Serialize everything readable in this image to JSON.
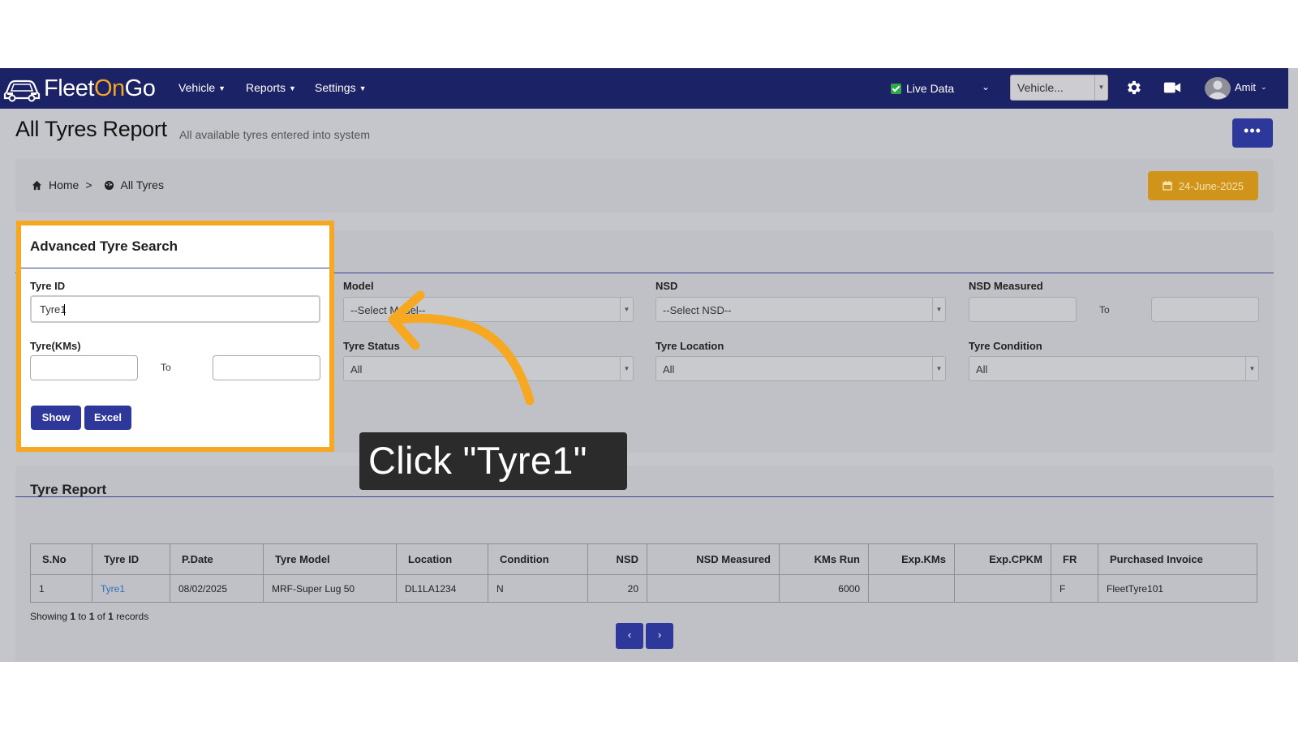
{
  "navbar": {
    "logo": {
      "part1": "Fleet",
      "part2": "On",
      "part3": "Go"
    },
    "menus": [
      {
        "label": "Vehicle"
      },
      {
        "label": "Reports"
      },
      {
        "label": "Settings"
      }
    ],
    "live_data_label": "Live Data",
    "live_data_checked": true,
    "vehicle_select_value": "Vehicle...",
    "user_name": "Amit"
  },
  "page": {
    "title": "All Tyres Report",
    "subtitle": "All available tyres entered into system",
    "more_label": "•••"
  },
  "breadcrumb": {
    "home": "Home",
    "separator": ">",
    "current": "All Tyres"
  },
  "date_label": "24-June-2025",
  "search": {
    "title": "Advanced Tyre Search",
    "tyre_id_label": "Tyre ID",
    "tyre_id_value": "Tyre1",
    "model_label": "Model",
    "model_value": "--Select Model--",
    "nsd_label": "NSD",
    "nsd_value": "--Select NSD--",
    "nsd_measured_label": "NSD Measured",
    "to_label": "To",
    "tyre_kms_label": "Tyre(KMs)",
    "tyre_status_label": "Tyre Status",
    "tyre_status_value": "All",
    "tyre_location_label": "Tyre Location",
    "tyre_location_value": "All",
    "tyre_condition_label": "Tyre Condition",
    "tyre_condition_value": "All",
    "show_label": "Show",
    "excel_label": "Excel"
  },
  "report": {
    "title": "Tyre Report",
    "columns": [
      "S.No",
      "Tyre ID",
      "P.Date",
      "Tyre Model",
      "Location",
      "Condition",
      "NSD",
      "NSD Measured",
      "KMs Run",
      "Exp.KMs",
      "Exp.CPKM",
      "FR",
      "Purchased Invoice"
    ],
    "rows": [
      [
        "1",
        "Tyre1",
        "08/02/2025",
        "MRF-Super Lug 50",
        "DL1LA1234",
        "N",
        "20",
        "",
        "6000",
        "",
        "",
        "F",
        "FleetTyre101"
      ]
    ],
    "showing": {
      "prefix": "Showing",
      "from": "1",
      "to_word": "to",
      "to": "1",
      "of_word": "of",
      "total": "1",
      "suffix": "records"
    },
    "prev_label": "‹",
    "next_label": "›"
  },
  "overlay": {
    "tooltip": "Click \"Tyre1\"",
    "highlight_color": "#f7a823",
    "arrow_color": "#f7a823"
  }
}
